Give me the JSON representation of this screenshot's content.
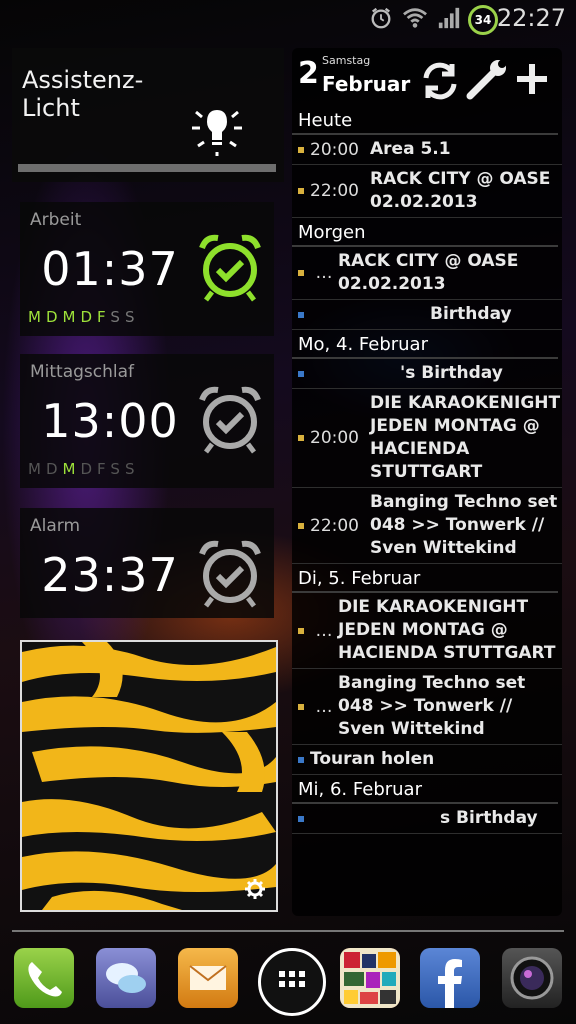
{
  "status_bar": {
    "time": "22:27",
    "battery": "34",
    "icons": [
      "alarm-icon",
      "wifi-icon",
      "signal-icon",
      "battery-icon"
    ]
  },
  "assist_widget": {
    "title": "Assistenz-\nLicht",
    "icon": "lightbulb-icon"
  },
  "alarms": [
    {
      "label": "Arbeit",
      "time": "01:37",
      "active": true,
      "days": [
        {
          "d": "M",
          "on": true
        },
        {
          "d": "D",
          "on": true
        },
        {
          "d": "M",
          "on": true
        },
        {
          "d": "D",
          "on": true
        },
        {
          "d": "F",
          "on": true
        },
        {
          "d": "S",
          "on": false
        },
        {
          "d": "S",
          "on": false
        }
      ]
    },
    {
      "label": "Mittagschlaf",
      "time": "13:00",
      "active": false,
      "days": [
        {
          "d": "M",
          "on": false
        },
        {
          "d": "D",
          "on": false
        },
        {
          "d": "M",
          "on": true
        },
        {
          "d": "D",
          "on": false
        },
        {
          "d": "F",
          "on": false
        },
        {
          "d": "S",
          "on": false
        },
        {
          "d": "S",
          "on": false
        }
      ]
    },
    {
      "label": "Alarm",
      "time": "23:37",
      "active": false,
      "days": []
    }
  ],
  "calendar": {
    "day": "2",
    "weekday": "Samstag",
    "month": "Februar",
    "tools": [
      "refresh-icon",
      "wrench-icon",
      "add-icon"
    ],
    "sections": [
      {
        "title": "Heute",
        "events": [
          {
            "time": "20:00",
            "title": "Area 5.1",
            "color": "#d9b13e"
          },
          {
            "time": "22:00",
            "title": "RACK CITY @ OASE\n02.02.2013",
            "color": "#d9b13e"
          }
        ]
      },
      {
        "title": "Morgen",
        "events": [
          {
            "time": "…",
            "title": "RACK CITY @ OASE\n02.02.2013",
            "color": "#d9b13e"
          },
          {
            "time": "",
            "title": "Birthday",
            "color": "#3a78c8"
          }
        ]
      },
      {
        "title": "Mo, 4. Februar",
        "events": [
          {
            "time": "",
            "title": "'s Birthday",
            "color": "#3a78c8"
          },
          {
            "time": "20:00",
            "title": "DIE KARAOKENIGHT JEDEN MONTAG @ HACIENDA STUTTGART",
            "color": "#d9b13e"
          },
          {
            "time": "22:00",
            "title": "Banging Techno set 048 >> Tonwerk // Sven Wittekind",
            "color": "#d9b13e"
          }
        ]
      },
      {
        "title": "Di, 5. Februar",
        "events": [
          {
            "time": "…",
            "title": "DIE KARAOKENIGHT JEDEN MONTAG @ HACIENDA STUTTGART",
            "color": "#d9b13e"
          },
          {
            "time": "…",
            "title": "Banging Techno set 048 >> Tonwerk // Sven Wittekind",
            "color": "#d9b13e"
          },
          {
            "time": "",
            "title": "Touran holen",
            "color": "#3a78c8"
          }
        ]
      },
      {
        "title": "Mi, 6. Februar",
        "events": [
          {
            "time": "",
            "title": "s Birthday",
            "color": "#3a78c8"
          }
        ]
      }
    ]
  },
  "dock": {
    "apps": [
      "phone-app",
      "messaging-app",
      "email-app",
      "app-drawer",
      "collage-app",
      "facebook-app",
      "camera-app"
    ]
  }
}
